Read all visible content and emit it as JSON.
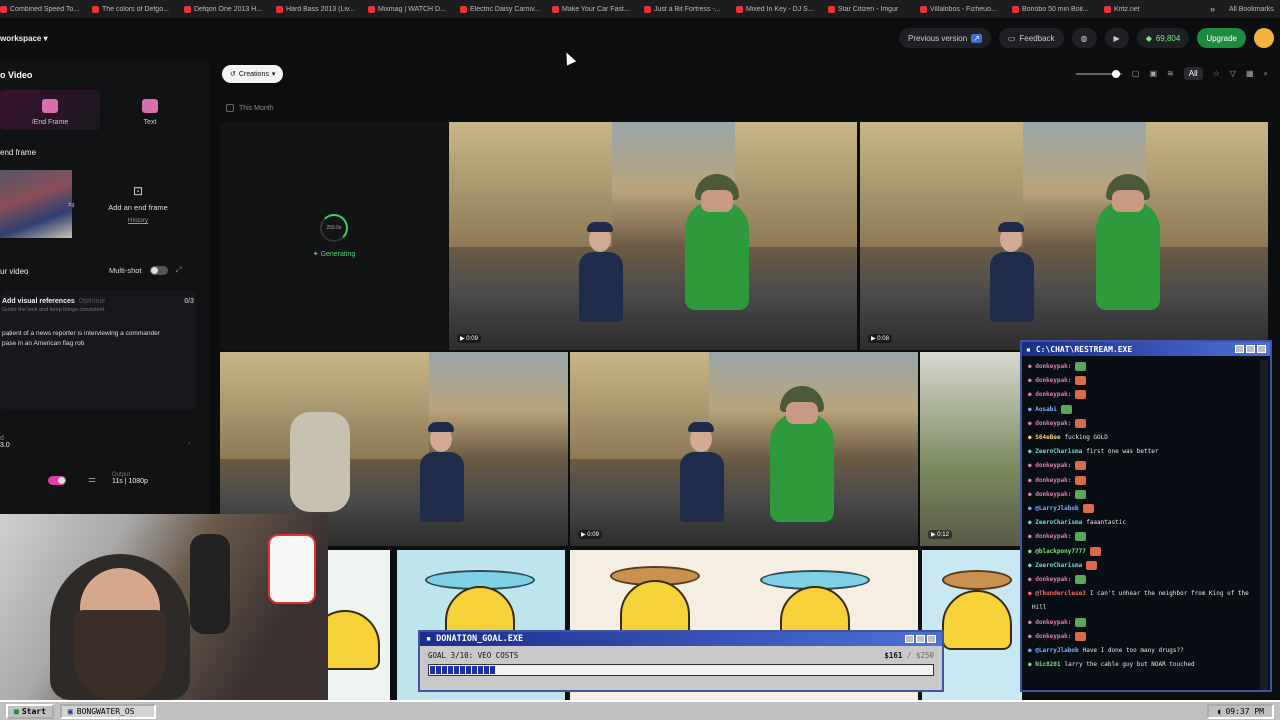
{
  "bookmarks": [
    "Combined Speed To...",
    "The colors of Defgo...",
    "Defqon One 2013 H...",
    "Hard Bass 2013 (Liv...",
    "Mixmag | WATCH D...",
    "Electric Daisy Carniv...",
    "Make Your Car Fast...",
    "Just a Bit Fortress -...",
    "Mixed In Key - DJ S...",
    "Star Citizen - Imgur",
    "Villalobos - Fizheuo...",
    "Bonobo 50 min Boil...",
    "Kritz.net"
  ],
  "bookmarks_more": "»",
  "all_bookmarks": "All Bookmarks",
  "header": {
    "workspace": "workspace",
    "previous_version": "Previous version",
    "feedback": "Feedback",
    "credits": "69,804",
    "upgrade": "Upgrade"
  },
  "sidebar": {
    "title": "o Video",
    "modes": [
      {
        "label": "/End Frame"
      },
      {
        "label": "Text"
      }
    ],
    "end_frame_section": "end frame",
    "add_end_frame": "Add an end frame",
    "history": "History",
    "your_video": "ur video",
    "multi_shot": "Multi-shot",
    "visual_refs": "Add visual references",
    "visual_refs_optional": "Optional",
    "visual_refs_count": "0/3",
    "visual_refs_hint": "Guide the look and keep things consistent.",
    "prompt_line1": "patient of a news reporter is interviewing a commander",
    "prompt_line2": "pase in an American flag rob",
    "model_label": "d",
    "model_value": "3.0",
    "output_label": "Output",
    "output_value": "11s | 1080p"
  },
  "main": {
    "filter_button": "Creations",
    "month_label": "This Month",
    "view_all": "All",
    "generating_progress": "259.0s",
    "generating_label": "Generating",
    "durations": [
      "0:09",
      "0:08",
      "0:09",
      "0:12"
    ]
  },
  "chat": {
    "title": "C:\\CHAT\\RESTREAM.EXE",
    "messages": [
      {
        "user": "donkeypak:",
        "text": "",
        "color": "pink"
      },
      {
        "user": "donkeypak:",
        "text": "",
        "color": "pink"
      },
      {
        "user": "donkeypak:",
        "text": "",
        "color": "pink"
      },
      {
        "user": "Aosabi",
        "text": "",
        "color": "blue"
      },
      {
        "user": "donkeypak:",
        "text": "",
        "color": "pink"
      },
      {
        "user": "S64eBee",
        "text": "fucking GOLD",
        "color": "yellow"
      },
      {
        "user": "ZeeroCharisma",
        "text": "first one was better",
        "color": "teal"
      },
      {
        "user": "donkeypak:",
        "text": "",
        "color": "pink"
      },
      {
        "user": "donkeypak:",
        "text": "",
        "color": "pink"
      },
      {
        "user": "donkeypak:",
        "text": "",
        "color": "pink"
      },
      {
        "user": "@LarryJlabob",
        "text": "",
        "color": "blue"
      },
      {
        "user": "ZeeroCharisma",
        "text": "faaantastic",
        "color": "teal"
      },
      {
        "user": "donkeypak:",
        "text": "",
        "color": "pink"
      },
      {
        "user": "@blackpony7777",
        "text": "",
        "color": "green"
      },
      {
        "user": "ZeeroCharisma",
        "text": "",
        "color": "teal"
      },
      {
        "user": "donkeypak:",
        "text": "",
        "color": "pink"
      },
      {
        "user": "@Thunderclese3",
        "text": "I can't unhear the neighbor from King of the",
        "color": "red"
      },
      {
        "user": "",
        "text": "Hill",
        "color": "red"
      },
      {
        "user": "donkeypak:",
        "text": "",
        "color": "pink"
      },
      {
        "user": "donkeypak:",
        "text": "",
        "color": "pink"
      },
      {
        "user": "@LarryJlabob",
        "text": "Have I done too many drugs??",
        "color": "blue"
      },
      {
        "user": "Nic8201",
        "text": "larry the cable guy but NOAR touched",
        "color": "green"
      }
    ]
  },
  "donation": {
    "title": "DONATION_GOAL.EXE",
    "goal_text": "GOAL 3/10: VEO COSTS",
    "raised": "$161",
    "target": "/ $250",
    "progress": 0.13
  },
  "taskbar": {
    "start": "Start",
    "window": "BONGWATER_OS",
    "time": "09:37 PM"
  },
  "colors": {
    "accent_pink": "#e13fa5",
    "credits_green": "#7ce28e",
    "upgrade_green": "#1c8b3d",
    "retro_blue": "#1a2e8a"
  }
}
